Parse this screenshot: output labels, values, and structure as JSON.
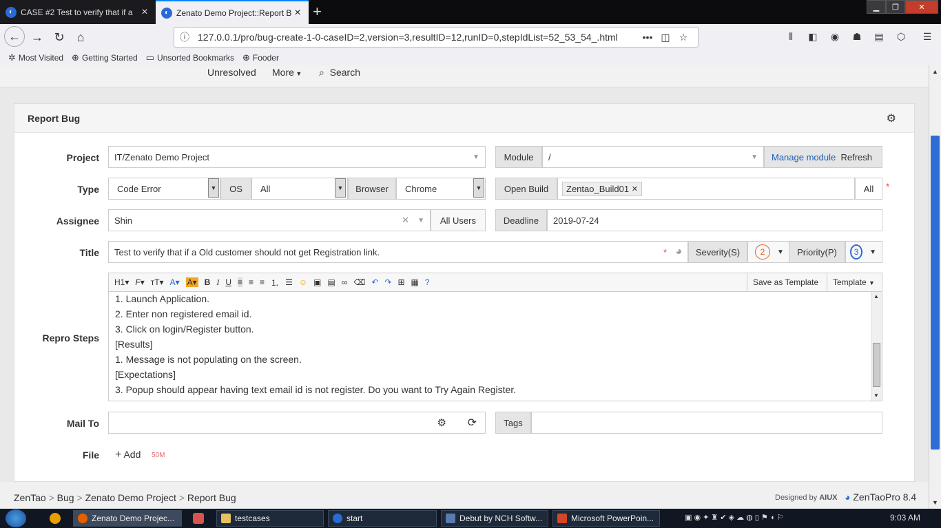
{
  "browser": {
    "tabs": [
      {
        "label": "CASE #2 Test to verify that if a",
        "active": false
      },
      {
        "label": "Zenato Demo Project::Report B",
        "active": true
      }
    ],
    "url": "127.0.0.1/pro/bug-create-1-0-caseID=2,version=3,resultID=12,runID=0,stepIdList=52_53_54_.html",
    "bookmarks": [
      "Most Visited",
      "Getting Started",
      "Unsorted Bookmarks",
      "Fooder"
    ]
  },
  "topmenu": {
    "unresolved": "Unresolved",
    "more": "More",
    "search": "Search"
  },
  "card": {
    "title": "Report Bug"
  },
  "form": {
    "project_label": "Project",
    "project_value": "IT/Zenato Demo Project",
    "module_label": "Module",
    "module_value": "/",
    "manage_module": "Manage module",
    "refresh": "Refresh",
    "type_label": "Type",
    "type_value": "Code Error",
    "os_label": "OS",
    "os_value": "All",
    "browser_label": "Browser",
    "browser_value": "Chrome",
    "open_build_label": "Open Build",
    "open_build_tag": "Zentao_Build01",
    "open_build_all": "All",
    "assignee_label": "Assignee",
    "assignee_value": "Shin",
    "all_users": "All Users",
    "deadline_label": "Deadline",
    "deadline_value": "2019-07-24",
    "title_label": "Title",
    "title_value": "Test to verify that if a Old customer should not get Registration link.",
    "severity_label": "Severity(S)",
    "severity_value": "2",
    "priority_label": "Priority(P)",
    "priority_value": "3",
    "repro_label": "Repro Steps",
    "save_template": "Save as Template",
    "template": "Template",
    "repro_lines": [
      "1. Launch Application.",
      "2. Enter non registered email id.",
      "3. Click on login/Register button.",
      "[Results]",
      "1. Message is not populating on the screen.",
      "[Expectations]",
      "3. Popup should appear having text email id is not register. Do you want to Try Again Register."
    ],
    "mailto_label": "Mail To",
    "tags_label": "Tags",
    "file_label": "File",
    "file_add": "Add",
    "file_limit": "50M"
  },
  "breadcrumb": {
    "items": [
      "ZenTao",
      "Bug",
      "Zenato Demo Project",
      "Report Bug"
    ],
    "designed_by": "Designed by",
    "aiux": "AIUX",
    "brand": "ZenTaoPro 8.4"
  },
  "taskbar": {
    "items": [
      "Zenato Demo Projec...",
      "testcases",
      "start",
      "Debut by NCH Softw...",
      "Microsoft PowerPoin..."
    ],
    "clock": "9:03 AM"
  }
}
